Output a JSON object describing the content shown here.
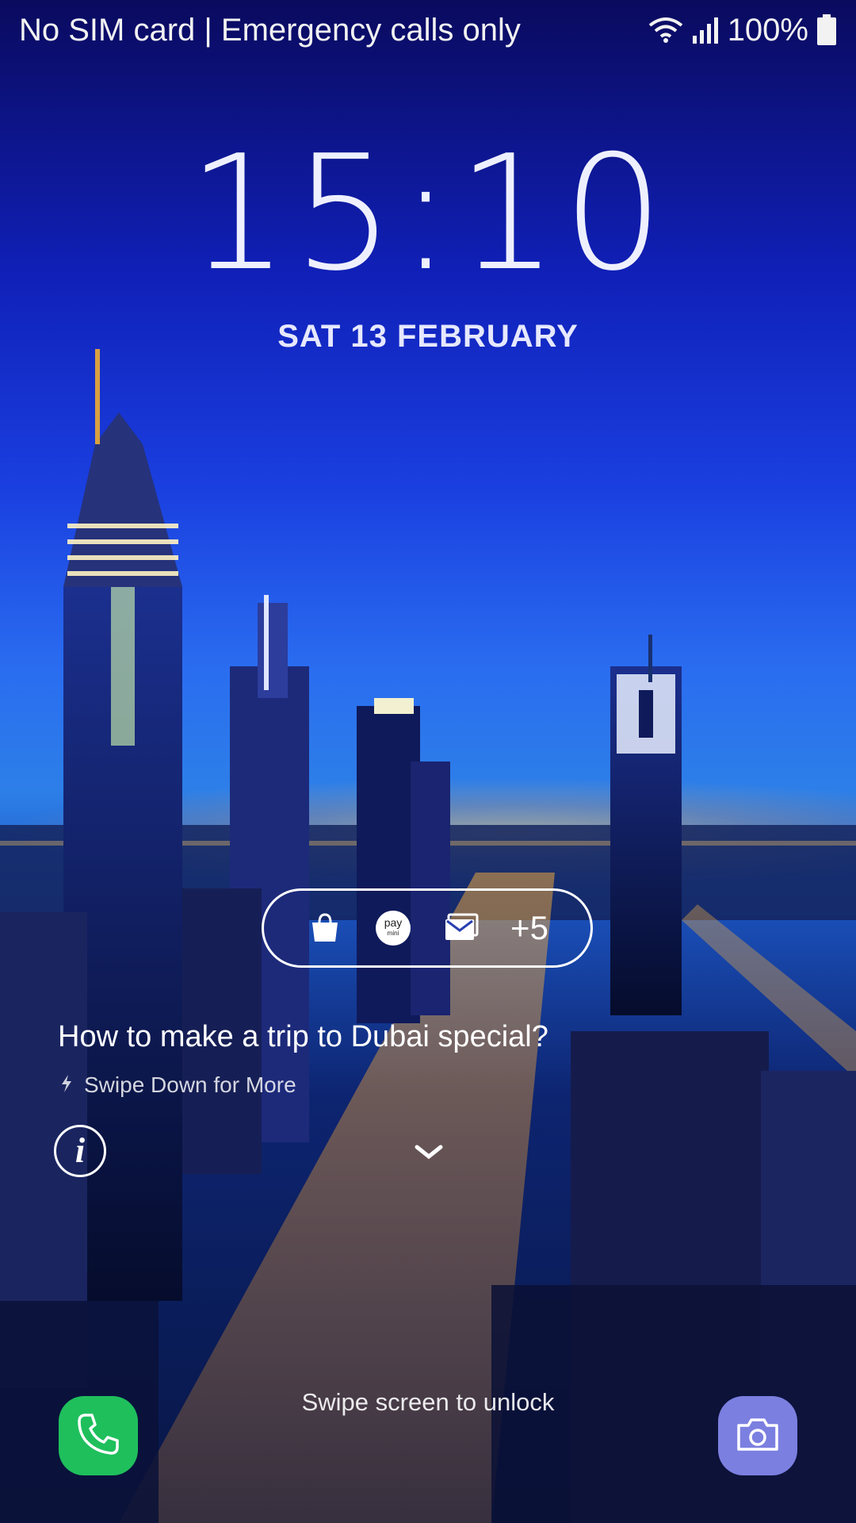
{
  "status_bar": {
    "carrier_text": "No SIM card | Emergency calls only",
    "battery_text": "100%",
    "icons": [
      "wifi-icon",
      "signal-icon",
      "battery-icon"
    ]
  },
  "lock_screen": {
    "time": "15:10",
    "date": "SAT 13 FEBRUARY"
  },
  "notifications": {
    "icons": [
      "shopping-bag-icon",
      "pay-mini-icon",
      "email-icon"
    ],
    "pay_label_top": "pay",
    "pay_label_bottom": "mini",
    "more_count": "+5"
  },
  "glance": {
    "headline": "How to make a trip to Dubai special?",
    "subline": "Swipe Down for More"
  },
  "bottom": {
    "unlock_hint": "Swipe screen to unlock",
    "left_shortcut": "phone-icon",
    "right_shortcut": "camera-icon"
  },
  "colors": {
    "phone_button": "#1fbf5c",
    "camera_button": "#7b7fe0"
  }
}
